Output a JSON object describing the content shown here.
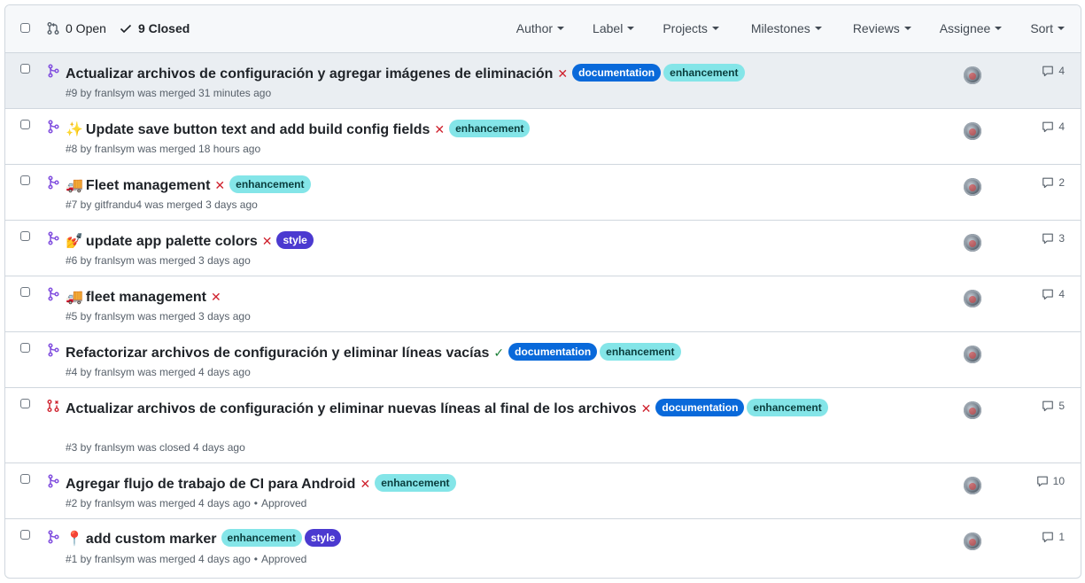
{
  "header": {
    "open_label": "0 Open",
    "closed_label": "9 Closed",
    "filters": [
      "Author",
      "Label",
      "Projects",
      "Milestones",
      "Reviews",
      "Assignee",
      "Sort"
    ]
  },
  "pulls": [
    {
      "emoji": "",
      "title": "Actualizar archivos de configuración y agregar imágenes de eliminación",
      "status": "✕",
      "labels": [
        "documentation",
        "enhancement"
      ],
      "meta": "#9 by franlsym was merged 31 minutes ago",
      "approved": "",
      "comments": "4"
    },
    {
      "emoji": "✨",
      "title": "Update save button text and add build config fields",
      "status": "✕",
      "labels": [
        "enhancement"
      ],
      "meta": "#8 by franlsym was merged 18 hours ago",
      "approved": "",
      "comments": "4"
    },
    {
      "emoji": "🚚",
      "title": "Fleet management",
      "status": "✕",
      "labels": [
        "enhancement"
      ],
      "meta": "#7 by gitfrandu4 was merged 3 days ago",
      "approved": "",
      "comments": "2"
    },
    {
      "emoji": "💅",
      "title": "update app palette colors",
      "status": "✕",
      "labels": [
        "style"
      ],
      "meta": "#6 by franlsym was merged 3 days ago",
      "approved": "",
      "comments": "3"
    },
    {
      "emoji": "🚚",
      "title": "fleet management",
      "status": "✕",
      "labels": [],
      "meta": "#5 by franlsym was merged 3 days ago",
      "approved": "",
      "comments": "4"
    },
    {
      "emoji": "",
      "title": "Refactorizar archivos de configuración y eliminar líneas vacías",
      "status": "✓",
      "labels": [
        "documentation",
        "enhancement"
      ],
      "meta": "#4 by franlsym was merged 4 days ago",
      "approved": "",
      "comments": ""
    },
    {
      "emoji": "",
      "title": "Actualizar archivos de configuración y eliminar nuevas líneas al final de los archivos",
      "status": "✕",
      "labels": [
        "documentation",
        "enhancement"
      ],
      "meta": "#3 by franlsym was closed 4 days ago",
      "approved": "",
      "comments": "5"
    },
    {
      "emoji": "",
      "title": "Agregar flujo de trabajo de CI para Android",
      "status": "✕",
      "labels": [
        "enhancement"
      ],
      "meta": "#2 by franlsym was merged 4 days ago",
      "approved": "Approved",
      "comments": "10"
    },
    {
      "emoji": "📍",
      "title": "add custom marker",
      "status": "",
      "labels": [
        "enhancement",
        "style"
      ],
      "meta": "#1 by franlsym was merged 4 days ago",
      "approved": "Approved",
      "comments": "1"
    }
  ],
  "colors": {
    "merged": "#8250df",
    "closed": "#cf222e",
    "fail": "#cf222e",
    "success": "#1a7f37",
    "documentation": "#0969da",
    "enhancement": "#84e5e8",
    "style": "#4b3ad0"
  }
}
